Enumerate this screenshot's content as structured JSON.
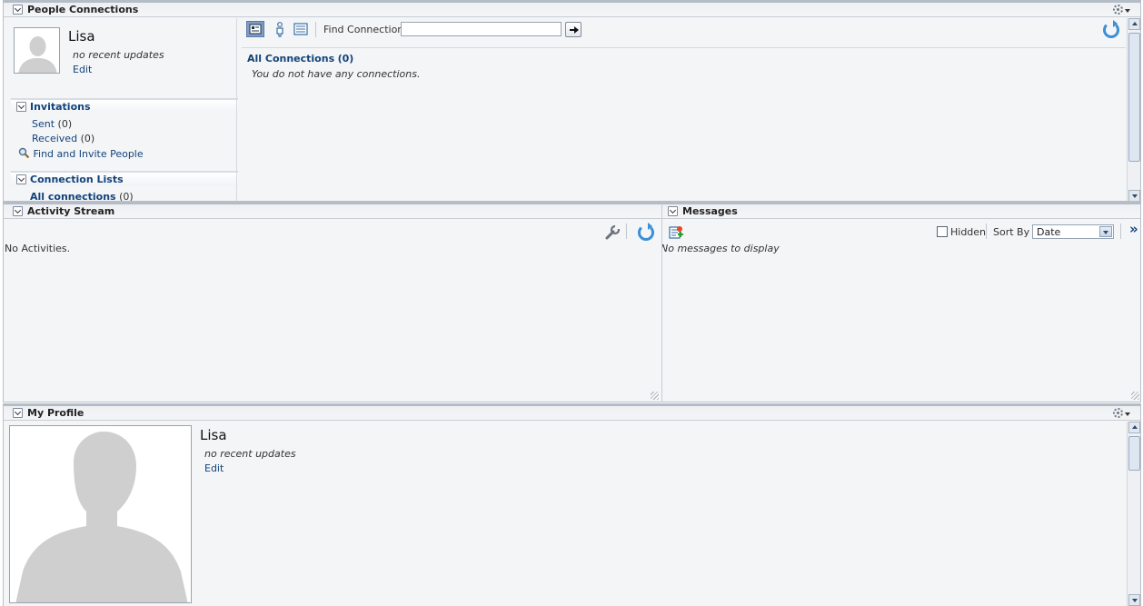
{
  "people_connections": {
    "title": "People Connections",
    "profile": {
      "name": "Lisa",
      "status": "no recent updates",
      "edit": "Edit"
    },
    "invitations": {
      "title": "Invitations",
      "sent_label": "Sent",
      "sent_count": "(0)",
      "received_label": "Received",
      "received_count": "(0)",
      "find_invite": "Find and Invite People"
    },
    "connection_lists": {
      "title": "Connection Lists",
      "all_label": "All connections",
      "all_count": "(0)"
    },
    "toolbar": {
      "find_label": "Find Connection",
      "find_value": ""
    },
    "results": {
      "header_label": "All Connections",
      "header_count": "(0)",
      "empty": "You do not have any connections."
    }
  },
  "activity_stream": {
    "title": "Activity Stream",
    "empty": "No Activities."
  },
  "messages": {
    "title": "Messages",
    "empty": "No messages to display",
    "hidden_label": "Hidden",
    "sort_by_label": "Sort By",
    "sort_value": "Date",
    "more": "»"
  },
  "my_profile": {
    "title": "My Profile",
    "name": "Lisa",
    "status": "no recent updates",
    "edit": "Edit"
  },
  "icons": {
    "collapse": "chevron-down-icon",
    "gear": "gear-menu-icon",
    "refresh": "refresh-icon",
    "search": "magnifier-icon",
    "wrench": "wrench-icon",
    "new_message": "new-message-icon",
    "go": "arrow-right-icon",
    "card_view": "card-view-icon",
    "person_view": "person-view-icon",
    "list_view": "list-view-icon"
  }
}
